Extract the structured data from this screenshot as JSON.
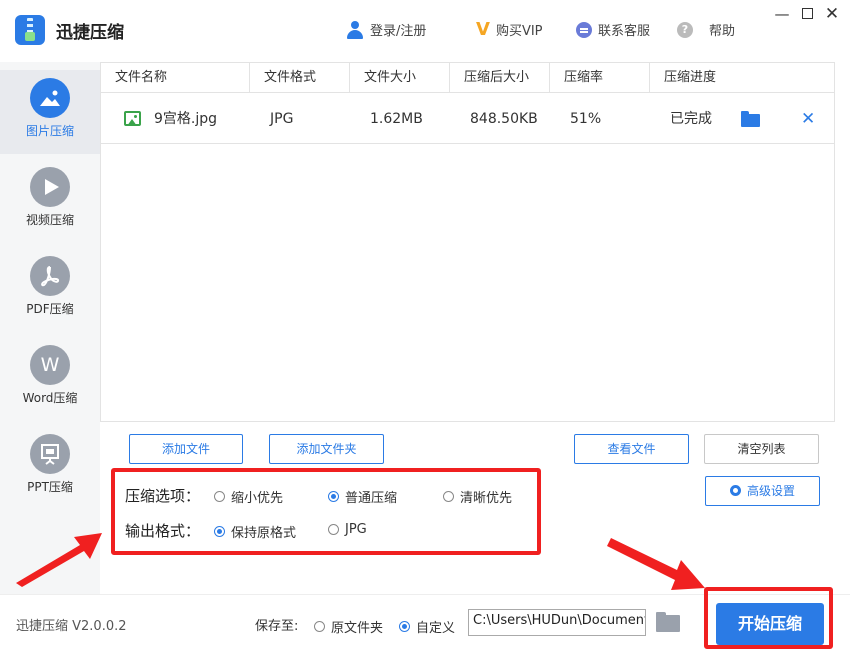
{
  "app": {
    "name": "迅捷压缩",
    "version": "迅捷压缩 V2.0.0.2"
  },
  "topnav": {
    "login": "登录/注册",
    "vip": "购买VIP",
    "service": "联系客服",
    "help": "帮助"
  },
  "sidebar": {
    "items": [
      {
        "label": "图片压缩",
        "icon": "image-icon",
        "glyph": "▲",
        "active": true
      },
      {
        "label": "视频压缩",
        "icon": "play-icon",
        "glyph": "▶",
        "active": false
      },
      {
        "label": "PDF压缩",
        "icon": "pdf-icon",
        "glyph": "A",
        "active": false
      },
      {
        "label": "Word压缩",
        "icon": "word-icon",
        "glyph": "W",
        "active": false
      },
      {
        "label": "PPT压缩",
        "icon": "ppt-icon",
        "glyph": "▣",
        "active": false
      }
    ]
  },
  "table": {
    "headers": [
      "文件名称",
      "文件格式",
      "文件大小",
      "压缩后大小",
      "压缩率",
      "压缩进度"
    ],
    "rows": [
      {
        "name": "9宫格.jpg",
        "format": "JPG",
        "size": "1.62MB",
        "compressed": "848.50KB",
        "ratio": "51%",
        "progress": "已完成"
      }
    ]
  },
  "buttons": {
    "add_file": "添加文件",
    "add_folder": "添加文件夹",
    "view_files": "查看文件",
    "clear_list": "清空列表",
    "advanced": "高级设置",
    "start": "开始压缩"
  },
  "options": {
    "compress_title": "压缩选项：",
    "compress_choices": [
      "缩小优先",
      "普通压缩",
      "清晰优先"
    ],
    "compress_selected": 1,
    "format_title": "输出格式：",
    "format_choices": [
      "保持原格式",
      "JPG"
    ],
    "format_selected": 0
  },
  "footer": {
    "save_label": "保存至:",
    "save_choices": [
      "原文件夹",
      "自定义"
    ],
    "save_selected": 1,
    "path": "C:\\Users\\HUDun\\Documents"
  },
  "colors": {
    "accent": "#2b7be5",
    "highlight": "#f02020"
  }
}
